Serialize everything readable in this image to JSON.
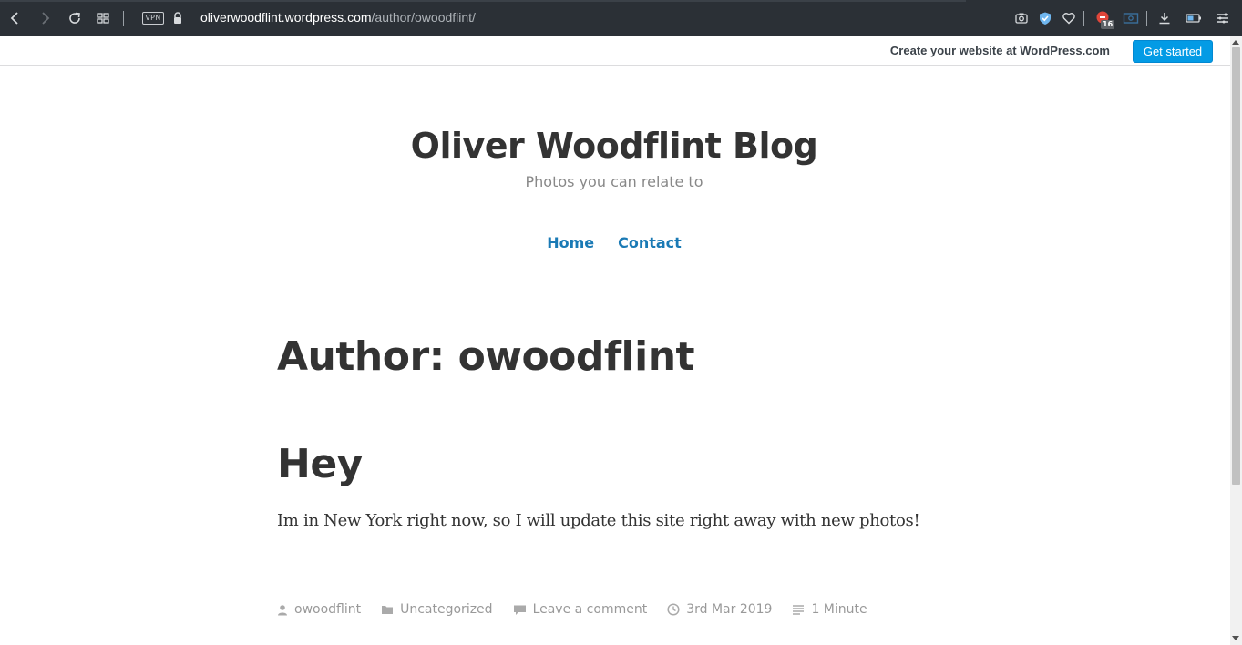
{
  "browser": {
    "url_host": "oliverwoodflint.wordpress.com",
    "url_path": "/author/owoodflint/",
    "vpn_label": "VPN",
    "adblock_count": "16",
    "icons": [
      "back-icon",
      "forward-icon",
      "reload-icon",
      "tabs-grid-icon",
      "vpn-icon",
      "lock-icon",
      "camera-icon",
      "shield-icon",
      "heart-icon",
      "adblock-icon",
      "screenshot-icon",
      "download-icon",
      "battery-icon",
      "menu-icon"
    ]
  },
  "wpbar": {
    "text": "Create your website at WordPress.com",
    "button": "Get started",
    "accent": "#039be5"
  },
  "site": {
    "title": "Oliver Woodflint Blog",
    "description": "Photos you can relate to",
    "nav": [
      "Home",
      "Contact"
    ],
    "link_color": "#1a7ab5"
  },
  "archive": {
    "title": "Author: owoodflint"
  },
  "post": {
    "title": "Hey",
    "excerpt": "Im in New York right now, so I will update this site right away with new photos!",
    "meta": {
      "author": "owoodflint",
      "category": "Uncategorized",
      "comments": "Leave a comment",
      "date": "3rd Mar 2019",
      "reading_time": "1 Minute"
    }
  }
}
